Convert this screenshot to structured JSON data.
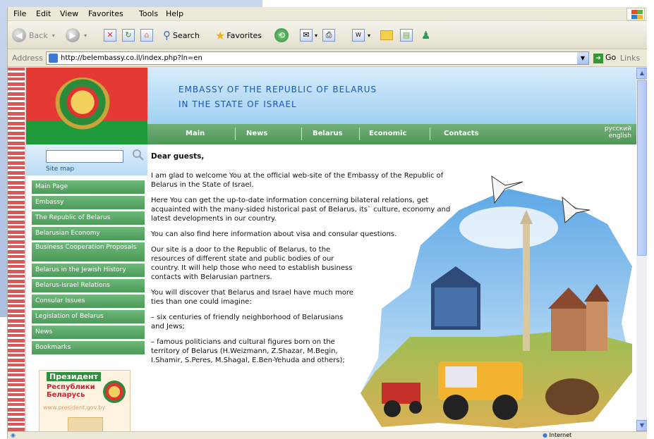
{
  "menubar": {
    "items": [
      "File",
      "Edit",
      "View",
      "Favorites",
      "Tools",
      "Help"
    ]
  },
  "toolbar": {
    "back": "Back",
    "search": "Search",
    "favorites": "Favorites"
  },
  "address": {
    "label": "Address",
    "url": "http://belembassy.co.il/index.php?ln=en",
    "go": "Go",
    "links": "Links"
  },
  "header": {
    "line1": "EMBASSY OF THE REPUBLIC OF BELARUS",
    "line2": "IN THE STATE OF ISRAEL"
  },
  "nav": {
    "items": [
      "Main",
      "News",
      "Belarus",
      "Economic",
      "Contacts"
    ],
    "lang_ru": "русский",
    "lang_en": "english"
  },
  "search": {
    "sitemap": "Site map"
  },
  "sidebar": {
    "items": [
      {
        "label": "Main Page"
      },
      {
        "label": "Embassy"
      },
      {
        "label": "The Republic of Belarus"
      },
      {
        "label": "Belarusian Economy"
      },
      {
        "label": "Business Cooperation Proposals"
      },
      {
        "label": "Belarus in the Jewish History"
      },
      {
        "label": "Belarus-Israel Relations"
      },
      {
        "label": "Consular Issues"
      },
      {
        "label": "Legislation of Belarus"
      },
      {
        "label": "News"
      },
      {
        "label": "Bookmarks"
      }
    ]
  },
  "banner": {
    "title": "Президент",
    "subtitle": "Республики Беларусь",
    "url": "www.president.gov.by"
  },
  "main": {
    "heading": "Dear guests,",
    "paragraphs": [
      "I am glad to welcome You at the official web-site of the Embassy of the Republic of Belarus in the State of Israel.",
      "Here You can get the up-to-date information concerning bilateral relations, get acquainted with the many-sided historical past of Belarus, its` culture, economy and latest developments in our country.",
      "You can also find here information about visa and consular questions.",
      "Our site is a door to the Republic of Belarus, to the resources of different state and public bodies of our country. It will help those who need to establish business contacts with Belarusian partners.",
      "You will discover that Belarus and Israel have much more ties than one could imagine:",
      "– six centuries of friendly neighborhood of Belarusians and Jews;",
      "– famous politicians and cultural figures born on the territory of Belarus (H.Weizmann, Z.Shazar, M.Begin, I.Shamir, S.Peres, M.Shagal, E.Ben-Yehuda and others);"
    ]
  },
  "status": {
    "zone": "Internet"
  }
}
